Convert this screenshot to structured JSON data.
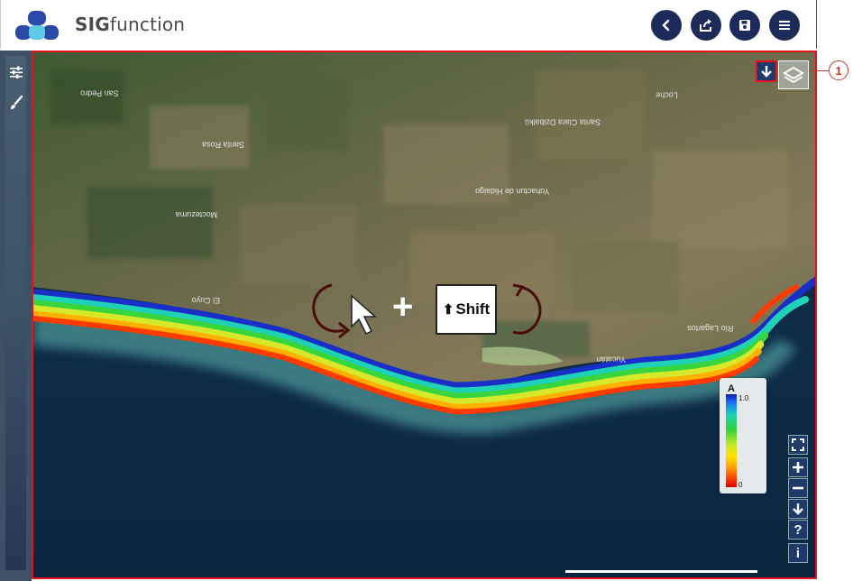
{
  "app": {
    "brand_bold": "SIG",
    "brand_rest": "function"
  },
  "header": {
    "buttons": [
      {
        "name": "back-button",
        "icon": "chevron-left-icon"
      },
      {
        "name": "share-button",
        "icon": "share-icon"
      },
      {
        "name": "save-button",
        "icon": "floppy-disk-icon"
      },
      {
        "name": "menu-button",
        "icon": "hamburger-menu-icon"
      }
    ]
  },
  "callout": {
    "number": "1"
  },
  "hint": {
    "shift_label": "Shift",
    "plus": "+"
  },
  "legend": {
    "title": "A",
    "max": "1.0",
    "min": "0"
  },
  "tools": {
    "help": "?",
    "info": "i"
  },
  "map_labels": [
    {
      "text": "San Pedro"
    },
    {
      "text": "Santa Rosa"
    },
    {
      "text": "Moctezuma"
    },
    {
      "text": "Santa Clara Dzibalkú"
    },
    {
      "text": "Yohactun de Hidalgo"
    },
    {
      "text": "Loche"
    },
    {
      "text": "El Cuyo"
    },
    {
      "text": "Río Lagartos"
    },
    {
      "text": "Yucatán"
    }
  ],
  "colors": {
    "accent": "#1d2b5a",
    "frame": "#e8101a",
    "sea": "#0d2a45"
  }
}
